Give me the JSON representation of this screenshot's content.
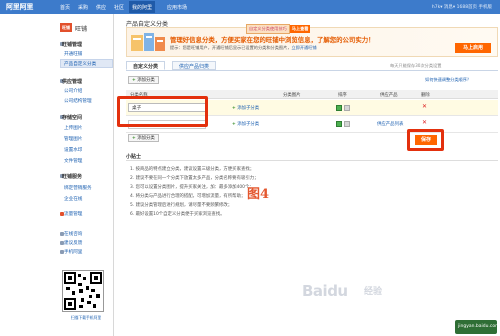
{
  "header": {
    "logo": "阿里阿里",
    "nav": [
      "首页",
      "采购",
      "供应",
      "社区",
      "我的阿里",
      "应用市场"
    ],
    "active_nav": "我的阿里",
    "right_text": "h7k▾   消息▾   1688首页   手机版"
  },
  "sidebar": {
    "shop_icon_text": "旺铺",
    "shop_name": "旺铺",
    "sections": [
      {
        "title": "旺铺管理",
        "items": [
          "开通旺铺",
          "产品自定义分类"
        ]
      },
      {
        "title": "供应管理",
        "items": [
          "公司介绍",
          "公司结构管理"
        ]
      },
      {
        "title": "存储空间",
        "items": [
          "上传图片",
          "管理图片",
          "设置水印",
          "文件管理"
        ]
      },
      {
        "title": "旺铺服务",
        "items": [
          "绑定营销服务",
          "企业在线"
        ]
      }
    ],
    "active_item": "产品自定义分类",
    "quick_links": [
      "流量管理",
      "在线咨询",
      "建议反馈",
      "手机阿里"
    ],
    "qr_caption": "扫描下载手机阿里"
  },
  "page": {
    "title": "产品自定义分类",
    "banner": {
      "pill_1": "自定义分类使用技巧",
      "pill_2": "马上查看",
      "headline": "管理好信息分类，方便买家在您的旺铺中浏览信息，了解您的公司实力！",
      "sub": "提示：您是旺铺用户，开通旺铺后显示已设置的分类和分类图片，",
      "sub_link": "立即开通旺铺",
      "button": "马上启用"
    },
    "tabs": [
      "自定义分类",
      "供应产品归类"
    ],
    "active_tab": "自定义分类",
    "tab_hint": "每天只能保存30次分类设置",
    "help_link": "如何快速调整分类顺序？",
    "add_category": "添加分类",
    "columns": [
      "分类名称",
      "分类图片",
      "排序",
      "供应产品",
      "删除"
    ],
    "rows": [
      {
        "name": "桌子",
        "add_sub": "添加子分类",
        "delete": "✕"
      },
      {
        "name": "",
        "add_sub": "添加子分类",
        "products": "供应产品列表",
        "delete": "✕"
      }
    ],
    "save": "保存",
    "tips_title": "小贴士",
    "tips": [
      "1. 按商品的特点建立分类，建议设置三级分类，方便买家查找；",
      "2. 建议不要在同一个分类下放置太多产品，分类名称要有吸引力；",
      "3. 您可以设置分类图片，提升买家关注，加：最多添加400个；",
      "4. 将分类与产品进行合理的搭配，可增加流量，有所帮助；",
      "5. 建议分类管理后进行规划，请尽量不要频繁修改；",
      "6. 最好设置10个自定义分类便于买家浏览查找。"
    ],
    "figure_label": "图4"
  },
  "watermark": {
    "baidu": "Baidu",
    "jingyan": "经验",
    "bottom": "jingyan.baidu.com"
  },
  "colors": {
    "topbar": "#3d7bcb",
    "accent_orange": "#ff6600",
    "highlight_red": "#e3300d",
    "link_blue": "#1b5fb0"
  }
}
